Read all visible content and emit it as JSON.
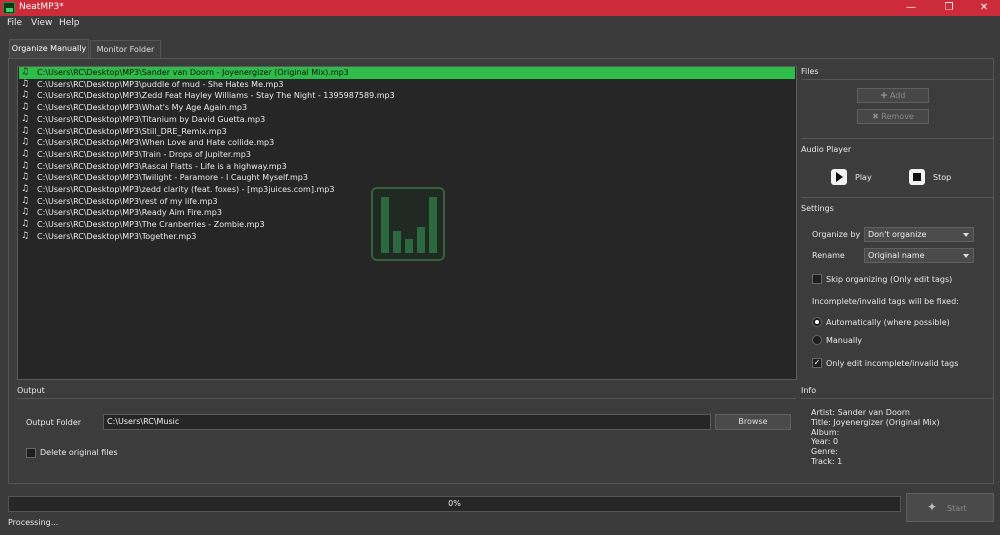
{
  "window": {
    "title": "NeatMP3*"
  },
  "menu": [
    "File",
    "View",
    "Help"
  ],
  "tabs": [
    "Organize Manually",
    "Monitor Folder"
  ],
  "files": [
    "C:\\Users\\RC\\Desktop\\MP3\\Sander van Doorn - Joyenergizer (Original Mix).mp3",
    "C:\\Users\\RC\\Desktop\\MP3\\puddle of mud - She Hates Me.mp3",
    "C:\\Users\\RC\\Desktop\\MP3\\Zedd Feat Hayley Williams - Stay The Night - 1395987589.mp3",
    "C:\\Users\\RC\\Desktop\\MP3\\What's My Age Again.mp3",
    "C:\\Users\\RC\\Desktop\\MP3\\Titanium by David Guetta.mp3",
    "C:\\Users\\RC\\Desktop\\MP3\\Still_DRE_Remix.mp3",
    "C:\\Users\\RC\\Desktop\\MP3\\When Love and Hate collide.mp3",
    "C:\\Users\\RC\\Desktop\\MP3\\Train - Drops of Jupiter.mp3",
    "C:\\Users\\RC\\Desktop\\MP3\\Rascal Flatts - Life is a highway.mp3",
    "C:\\Users\\RC\\Desktop\\MP3\\Twilight - Paramore - I Caught Myself.mp3",
    "C:\\Users\\RC\\Desktop\\MP3\\zedd clarity (feat. foxes) - [mp3juices.com].mp3",
    "C:\\Users\\RC\\Desktop\\MP3\\rest of my life.mp3",
    "C:\\Users\\RC\\Desktop\\MP3\\Ready Aim Fire.mp3",
    "C:\\Users\\RC\\Desktop\\MP3\\The Cranberries - Zombie.mp3",
    "C:\\Users\\RC\\Desktop\\MP3\\Together.mp3"
  ],
  "sections": {
    "files": "Files",
    "audio_player": "Audio Player",
    "settings": "Settings",
    "output": "Output",
    "info": "Info"
  },
  "files_panel": {
    "add": "Add",
    "remove": "Remove"
  },
  "player": {
    "play": "Play",
    "stop": "Stop"
  },
  "settings": {
    "organize_by_label": "Organize by",
    "organize_by_value": "Don't organize",
    "rename_label": "Rename",
    "rename_value": "Original name",
    "skip_organizing": "Skip organizing (Only edit tags)",
    "fix_label": "Incomplete/invalid tags will be fixed:",
    "auto": "Automatically (where possible)",
    "manual": "Manually",
    "only_edit": "Only edit incomplete/invalid tags"
  },
  "output": {
    "folder_label": "Output Folder",
    "folder_value": "C:\\Users\\RC\\Music",
    "browse": "Browse",
    "delete_original": "Delete original files"
  },
  "info": [
    "Artist: Sander van Doorn",
    "Title:  Joyenergizer (Original Mix)",
    "Album:",
    "Year: 0",
    "Genre:",
    "Track: 1"
  ],
  "progress": {
    "text": "0%",
    "fraction": 0
  },
  "start": "Start",
  "status": "Processing..."
}
